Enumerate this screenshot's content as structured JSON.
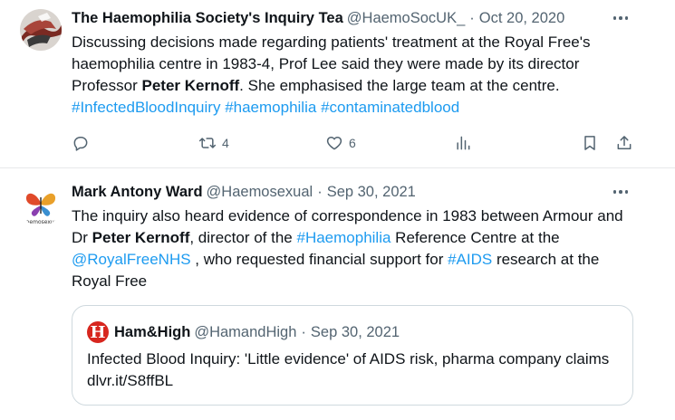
{
  "tweet1": {
    "author_name": "The Haemophilia Society's Inquiry Tea",
    "handle": "@HaemoSocUK_",
    "date": "Oct 20, 2020",
    "text_part1": "Discussing decisions made regarding patients' treatment at the Royal Free's haemophilia centre in 1983-4, Prof Lee said they were made by its director Professor ",
    "text_bold": "Peter Kernoff",
    "text_part2": ". She emphasised the large team at the centre. ",
    "hashtags": [
      "#InfectedBloodInquiry",
      "#haemophilia",
      "#contaminatedblood"
    ],
    "actions": {
      "reply_count": "",
      "retweet_count": "4",
      "like_count": "6",
      "views_count": ""
    }
  },
  "tweet2": {
    "author_name": "Mark Antony Ward",
    "handle": "@Haemosexual",
    "date": "Sep 30, 2021",
    "avatar_caption": "haemosexual",
    "text": {
      "p1": "The inquiry also heard evidence of correspondence in 1983 between Armour and Dr ",
      "bold": "Peter Kernoff",
      "p2": ", director of the ",
      "tag1": "#Haemophilia",
      "p3": " Reference Centre at the ",
      "mention": "@RoyalFreeNHS",
      "p4": " , who requested financial support for ",
      "tag2": "#AIDS",
      "p5": " research at the Royal Free"
    },
    "quote": {
      "logo_letter": "H",
      "name": "Ham&High",
      "handle": "@HamandHigh",
      "date": "Sep 30, 2021",
      "text": "Infected Blood Inquiry: 'Little evidence' of AIDS risk, pharma company claims dlvr.it/S8ffBL"
    }
  },
  "separator": "·",
  "colors": {
    "link": "#1d9bf0",
    "muted": "#536471",
    "text": "#0f1419",
    "border": "#cfd9de",
    "brand_red": "#d7261e"
  },
  "icons": [
    "more-icon",
    "reply-icon",
    "retweet-icon",
    "like-icon",
    "views-icon",
    "bookmark-icon",
    "share-icon"
  ]
}
